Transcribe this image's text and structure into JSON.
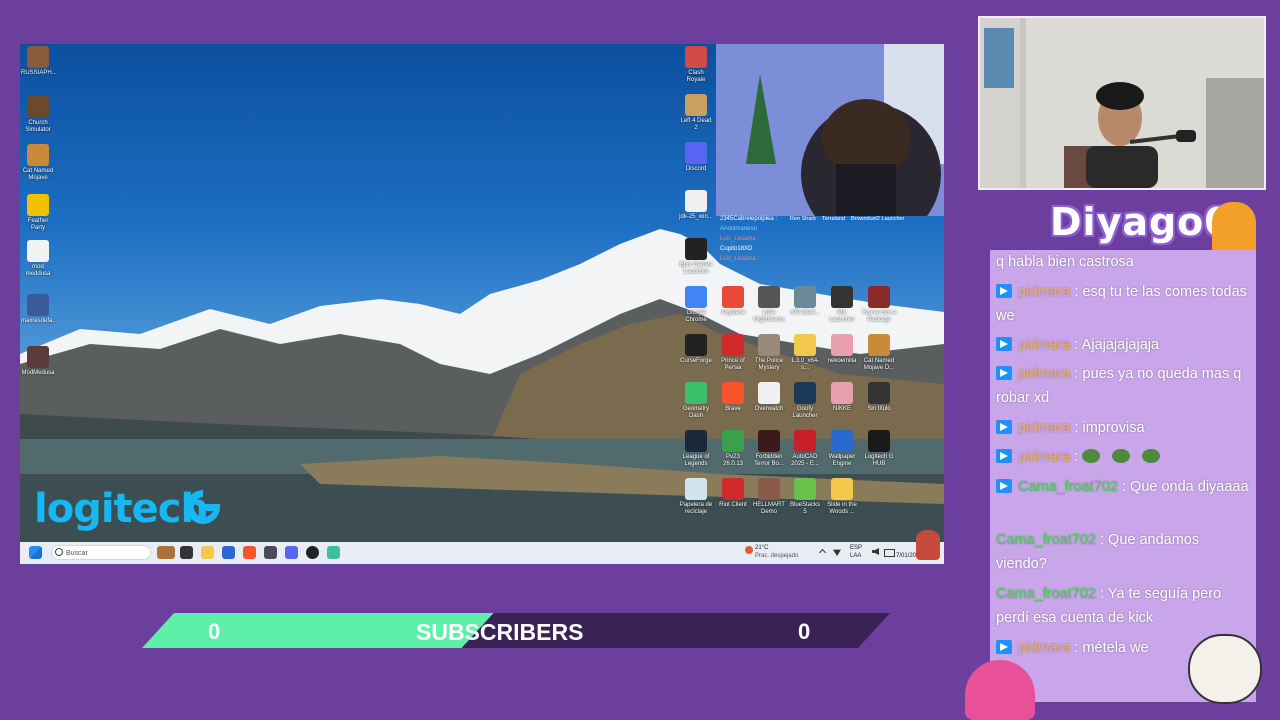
{
  "desktop": {
    "wallpaper_brand": "logitech",
    "left_icons": [
      {
        "label": "RUSSIAPH...",
        "icon": "game-icon",
        "color": "#8a5a3a"
      },
      {
        "label": "Church Simulator",
        "icon": "game-icon",
        "color": "#6a4a2a"
      },
      {
        "label": "Cat Named Mojave",
        "icon": "cat-icon",
        "color": "#c98a3a"
      },
      {
        "label": "Feather Party",
        "icon": "bird-icon",
        "color": "#f2c200"
      },
      {
        "label": "mod meddusa",
        "icon": "file-icon",
        "color": "#f2f2f2"
      },
      {
        "label": "maxresdefa...",
        "icon": "image-icon",
        "color": "#3a5a9a"
      },
      {
        "label": "ModMedusa",
        "icon": "folder-icon",
        "color": "#5a3a3a"
      }
    ],
    "right_icons": [
      {
        "label": "Clash Royale",
        "color": "#d04a4a"
      },
      {
        "label": "Left 4 Dead 2",
        "color": "#c9a060"
      },
      {
        "label": "Discord",
        "color": "#5865f2"
      },
      {
        "label": "jdk-25_win...",
        "color": "#f0f0f0"
      },
      {
        "label": "Epic Games Launcher",
        "color": "#222222"
      },
      {
        "label": "Google Chrome",
        "color": "#4285f4"
      },
      {
        "label": "AnyDesk",
        "color": "#e84a3a"
      },
      {
        "label": "Little Nightmares",
        "color": "#555555"
      },
      {
        "label": "c90-2024...",
        "color": "#6a8a9a"
      },
      {
        "label": "MK Launcher",
        "color": "#333333"
      },
      {
        "label": "You've Got a Package",
        "color": "#8a2a2a"
      },
      {
        "label": "CurseForge",
        "color": "#222222"
      },
      {
        "label": "Prince of Persia",
        "color": "#d02a2a"
      },
      {
        "label": "The Police Mystery",
        "color": "#9a8a7a"
      },
      {
        "label": "1.3.0_x64-s...",
        "color": "#f2c94c"
      },
      {
        "label": "nekoemilia",
        "color": "#e8a0b0"
      },
      {
        "label": "Cat Named Mojave D...",
        "color": "#c98a3a"
      },
      {
        "label": "Geometry Dash",
        "color": "#3ac06a"
      },
      {
        "label": "Brave",
        "color": "#fb542b"
      },
      {
        "label": "Overwatch",
        "color": "#f0f0f0"
      },
      {
        "label": "Goofy Launcher",
        "color": "#1a3a5a"
      },
      {
        "label": "NIKKE",
        "color": "#e8a0b0"
      },
      {
        "label": "Sin título",
        "color": "#333333"
      },
      {
        "label": "League of Legends",
        "color": "#1a2a3a"
      },
      {
        "label": "PvZ3 26.0.13",
        "color": "#3aa04a"
      },
      {
        "label": "Forbidden Terror Bo...",
        "color": "#3a1a1a"
      },
      {
        "label": "AutoCAD 2025 - E...",
        "color": "#c8202a"
      },
      {
        "label": "Wallpaper Engine",
        "color": "#2a6ad0"
      },
      {
        "label": "Logitech G HUB",
        "color": "#1a1a1a"
      },
      {
        "label": "Papelera de reciclaje",
        "color": "#d0e4f0"
      },
      {
        "label": "Riot Client",
        "color": "#d02a2a"
      },
      {
        "label": "HELLMART Demo",
        "color": "#8a5a4a"
      },
      {
        "label": "BlueStacks 5",
        "color": "#6ac04a"
      },
      {
        "label": "Slide in the Woods ...",
        "color": "#f2c94c"
      }
    ],
    "row2_labels": [
      "Ren Shark",
      "Terraland",
      "Browndust2 Launcher"
    ],
    "overlay_chat": [
      "2345Cabrelepolplea :",
      "Anonimaneou",
      "Luis_Lesama :",
      "Cupito18XD",
      "Luis_Lesama :"
    ],
    "taskbar": {
      "search_placeholder": "Buscar",
      "weather_temp": "21°C",
      "weather_desc": "Prac. despejado",
      "lang_1": "ESP",
      "lang_2": "LAA",
      "time": "",
      "date": "7/01/2026"
    }
  },
  "stream": {
    "channel_name": "Diyago0",
    "subscribers": {
      "label": "SUBSCRIBERS",
      "current": "0",
      "goal": "0",
      "fill_fraction": 0.47
    }
  },
  "chat": [
    {
      "user": "",
      "text": "q habla bien castrosa",
      "badge": false,
      "color": ""
    },
    {
      "user": "pidmara",
      "text": " : esq tu te las comes todas we",
      "badge": true,
      "color": "p"
    },
    {
      "user": "pidmara",
      "text": " : Ajajajajajaja",
      "badge": true,
      "color": "p"
    },
    {
      "user": "pidmara",
      "text": " : pues ya no queda mas q robar xd",
      "badge": true,
      "color": "p"
    },
    {
      "user": "pidmara",
      "text": " : improvisa",
      "badge": true,
      "color": "p"
    },
    {
      "user": "pidmara",
      "text": " : ",
      "badge": true,
      "color": "p"
    },
    {
      "user": "Cama_froat702",
      "text": " : Que onda diyaaaa",
      "badge": true,
      "color": "c"
    },
    {
      "user": "Cama_froat702",
      "text": " : Que andamos viendo?",
      "badge": false,
      "color": "c"
    },
    {
      "user": "Cama_froat702",
      "text": " : Ya te seguía pero perdí esa cuenta de kick",
      "badge": false,
      "color": "c"
    },
    {
      "user": "pidmara",
      "text": " : métela we",
      "badge": true,
      "color": "p"
    }
  ]
}
